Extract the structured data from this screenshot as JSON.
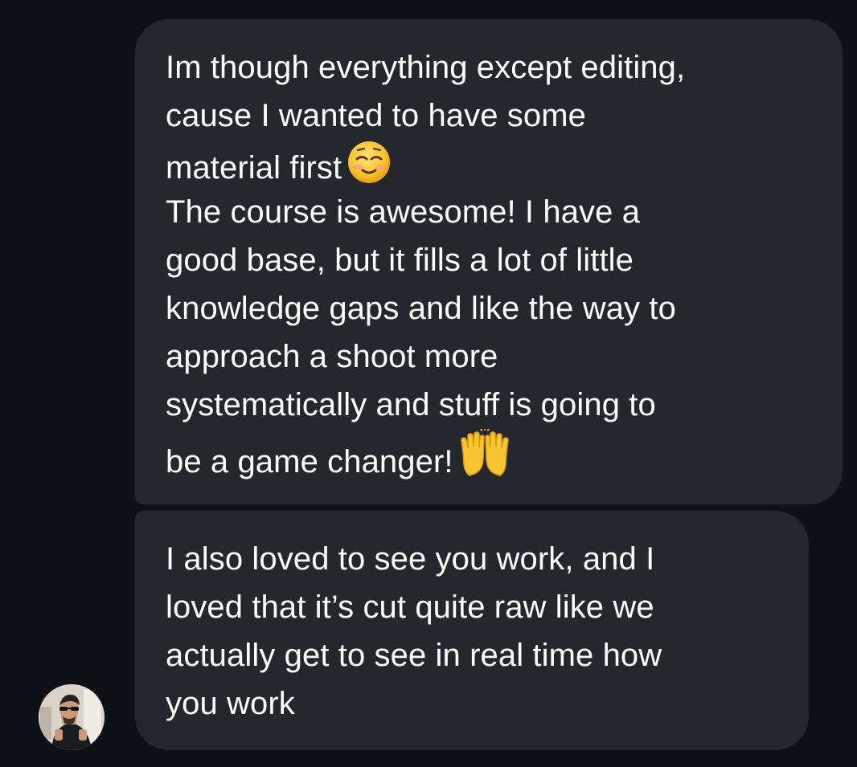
{
  "conversation": {
    "messages": [
      {
        "lines": [
          "Im though everything except editing,",
          "cause I wanted to have some",
          "material first",
          "The course is awesome! I have a",
          "good base, but it fills a lot of little",
          "knowledge gaps and like the way to",
          "approach a shoot more",
          "systematically and stuff is going to",
          "be a game changer!"
        ],
        "emojis": [
          "smiling-face-icon",
          "raising-hands-icon"
        ]
      },
      {
        "lines": [
          "I also loved to see you work, and I",
          "loved that it’s cut quite raw like we",
          "actually get to see in real time how",
          "you work"
        ]
      }
    ],
    "sender": {
      "avatar_icon": "avatar-photo"
    }
  },
  "colors": {
    "background": "#0e1116",
    "bubble": "#25272c",
    "text": "#ffffff"
  }
}
